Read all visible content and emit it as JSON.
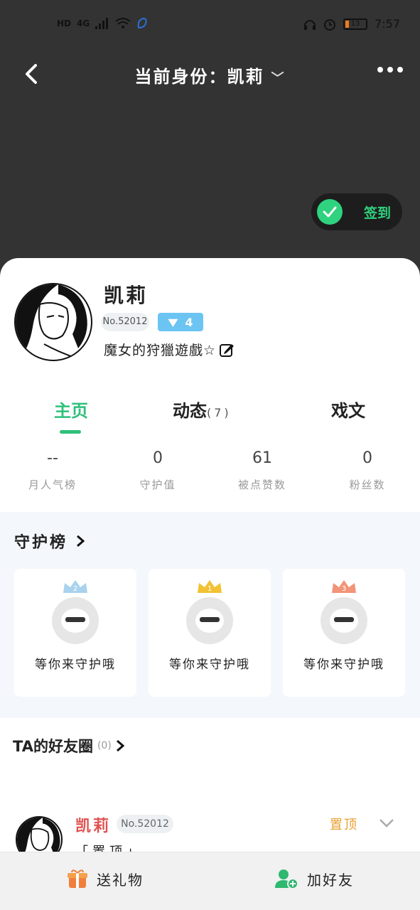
{
  "status_bar": {
    "left_chips": [
      "HD",
      "4G"
    ],
    "time": "7:57",
    "battery": "13"
  },
  "nav": {
    "title": "当前身份：凯莉",
    "title_caret": "﹀"
  },
  "checkin": {
    "label": "签到"
  },
  "profile": {
    "name": "凯莉",
    "number": "No.52012",
    "level": "4",
    "bio": "魔女的狩獵遊戲☆"
  },
  "tabs": [
    {
      "label": "主页",
      "count": ""
    },
    {
      "label": "动态",
      "count": "(7)"
    },
    {
      "label": "戏文",
      "count": ""
    }
  ],
  "stats": [
    {
      "value": "--",
      "label": "月人气榜"
    },
    {
      "value": "0",
      "label": "守护值"
    },
    {
      "value": "61",
      "label": "被点赞数"
    },
    {
      "value": "0",
      "label": "粉丝数"
    }
  ],
  "guard": {
    "title": "守护榜",
    "cards": [
      {
        "rank": "2",
        "text": "等你来守护哦",
        "crown_color": "#a9d2ee"
      },
      {
        "rank": "1",
        "text": "等你来守护哦",
        "crown_color": "#f2c234"
      },
      {
        "rank": "3",
        "text": "等你来守护哦",
        "crown_color": "#f29478"
      }
    ]
  },
  "friends": {
    "title": "TA的好友圈",
    "count": "(0)"
  },
  "post": {
    "name": "凯莉",
    "number": "No.52012",
    "pin_label": "置顶",
    "tag": "「置顶」"
  },
  "bottom_bar": {
    "gift_label": "送礼物",
    "add_friend_label": "加好友"
  },
  "colors": {
    "accent_green": "#2fc07a",
    "checkin_green": "#2fd27e",
    "level_blue": "#6cc4f3",
    "post_name_red": "#e05252",
    "pin_orange": "#e8a030"
  }
}
